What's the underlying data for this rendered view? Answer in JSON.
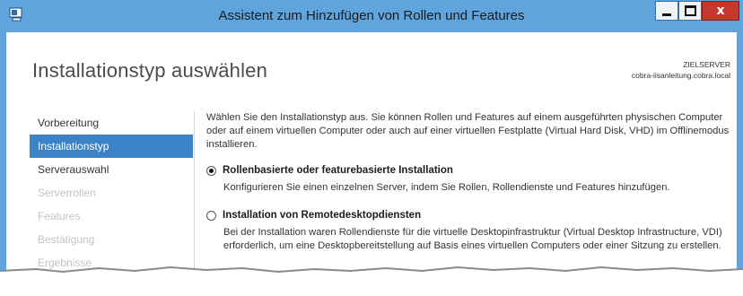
{
  "window": {
    "title": "Assistent zum Hinzufügen von Rollen und Features",
    "controls": {
      "minimize": "minimize-icon",
      "maximize": "maximize-icon",
      "close": "close-icon"
    }
  },
  "header": {
    "page_title": "Installationstyp auswählen",
    "target_label": "ZIELSERVER",
    "target_server": "cobra-iisanleitung.cobra.local"
  },
  "sidebar": {
    "items": [
      {
        "label": "Vorbereitung",
        "state": "enabled"
      },
      {
        "label": "Installationstyp",
        "state": "selected"
      },
      {
        "label": "Serverauswahl",
        "state": "enabled"
      },
      {
        "label": "Serverrollen",
        "state": "disabled"
      },
      {
        "label": "Features",
        "state": "disabled"
      },
      {
        "label": "Bestätigung",
        "state": "disabled"
      },
      {
        "label": "Ergebnisse",
        "state": "disabled"
      }
    ]
  },
  "main": {
    "intro": "Wählen Sie den Installationstyp aus. Sie können Rollen und Features auf einem ausgeführten physischen Computer oder auf einem virtuellen Computer oder auch auf einer virtuellen Festplatte (Virtual Hard Disk, VHD) im Offlinemodus installieren.",
    "options": [
      {
        "label": "Rollenbasierte oder featurebasierte Installation",
        "description": "Konfigurieren Sie einen einzelnen Server, indem Sie Rollen, Rollendienste und Features hinzufügen.",
        "selected": true
      },
      {
        "label": "Installation von Remotedesktopdiensten",
        "description": "Bei der Installation waren Rollendienste für die virtuelle Desktopinfrastruktur (Virtual Desktop Infrastructure, VDI) erforderlich, um eine Desktopbereitstellung auf Basis eines virtuellen Computers oder einer Sitzung zu erstellen.",
        "selected": false
      }
    ]
  },
  "colors": {
    "titlebar": "#5fa4dd",
    "nav_selected": "#3c82c6",
    "close_button": "#c7382c"
  }
}
